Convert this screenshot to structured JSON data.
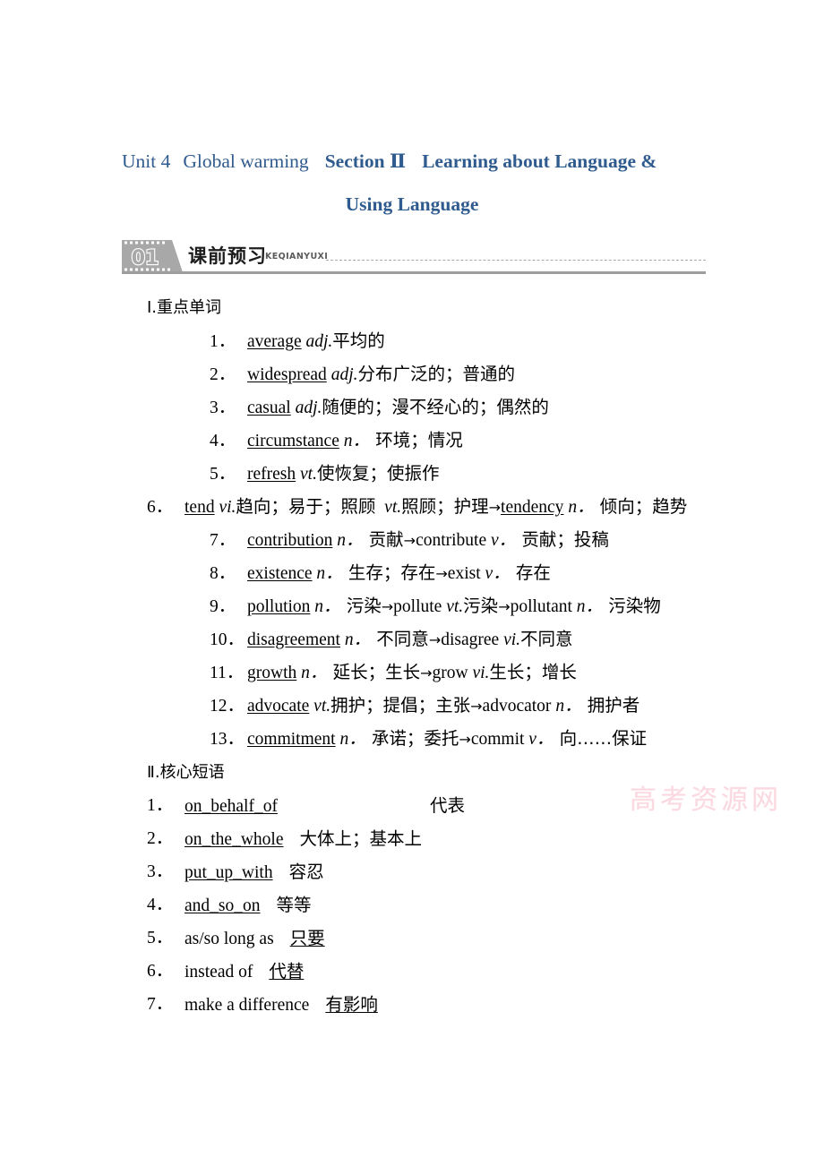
{
  "title": {
    "unit": "Unit 4",
    "topic": "Global warming",
    "section": "Section Ⅱ",
    "lesson_line1": "Learning about Language &",
    "lesson_line2": "Using Language"
  },
  "banner": {
    "number": "01",
    "cn": "课前预习",
    "pinyin": "KEQIANYUXI"
  },
  "watermark": "高考资源网",
  "colors": {
    "title_blue": "#2f5b8e",
    "rule_gray": "#9e9e9e",
    "watermark_pink": "#f9b9c8"
  },
  "section1": {
    "heading": "Ⅰ.重点单词",
    "items": [
      {
        "n": "1．",
        "word": "average",
        "pos": "adj.",
        "def": "平均的",
        "extra": ""
      },
      {
        "n": "2．",
        "word": "widespread",
        "pos": "adj.",
        "def": "分布广泛的；普通的",
        "extra": ""
      },
      {
        "n": "3．",
        "word": "casual",
        "pos": "adj.",
        "def": "随便的；漫不经心的；偶然的",
        "extra": ""
      },
      {
        "n": "4．",
        "word": "circumstance",
        "pos": "n．",
        "def": " 环境；情况",
        "extra": ""
      },
      {
        "n": "5．",
        "word": "refresh",
        "pos": "vt.",
        "def": "使恢复；使振作",
        "extra": ""
      },
      {
        "n": "6．",
        "word": "tend",
        "pos": "vi.",
        "def": "趋向；易于；照顾",
        "pos2": "vt.",
        "def2": "照顾；护理",
        "deriv": "tendency",
        "deriv_pos": "n．",
        "deriv_def": " 倾向；趋势"
      },
      {
        "n": "7．",
        "word": "contribution",
        "pos": "n．",
        "def": " 贡献",
        "deriv": "contribute",
        "deriv_pos": "v．",
        "deriv_def": " 贡献；投稿"
      },
      {
        "n": "8．",
        "word": "existence",
        "pos": "n．",
        "def": " 生存；存在",
        "deriv": "exist",
        "deriv_pos": "v．",
        "deriv_def": " 存在"
      },
      {
        "n": "9．",
        "word": "pollution",
        "pos": "n．",
        "def": " 污染",
        "deriv": "pollute",
        "deriv_pos": "vt.",
        "deriv_def": "污染",
        "deriv2": "pollutant",
        "deriv2_pos": "n．",
        "deriv2_def": " 污染物"
      },
      {
        "n": "10．",
        "word": "disagreement",
        "pos": "n．",
        "def": " 不同意",
        "deriv": "disagree",
        "deriv_pos": "vi.",
        "deriv_def": "不同意"
      },
      {
        "n": "11．",
        "word": "growth",
        "pos": "n．",
        "def": " 延长；生长",
        "deriv": "grow",
        "deriv_pos": "vi.",
        "deriv_def": "生长；增长"
      },
      {
        "n": "12．",
        "word": "advocate",
        "pos": "vt.",
        "def": "拥护；提倡；主张",
        "deriv": "advocator",
        "deriv_pos": "n．",
        "deriv_def": " 拥护者"
      },
      {
        "n": "13．",
        "word": "commitment",
        "pos": "n．",
        "def": " 承诺；委托",
        "deriv": "commit",
        "deriv_pos": "v．",
        "deriv_def": " 向……保证"
      }
    ],
    "item6_wrap": "趋势",
    "arrow": "→"
  },
  "section2": {
    "heading": "Ⅱ.核心短语",
    "items": [
      {
        "n": "1．",
        "en": "on_behalf_of",
        "en_underline": true,
        "cn": "代表",
        "cn_underline": false,
        "gap": "wide"
      },
      {
        "n": "2．",
        "en": "on_the_whole",
        "en_underline": true,
        "cn": "大体上；基本上",
        "cn_underline": false,
        "gap": "med"
      },
      {
        "n": "3．",
        "en": "put_up_with",
        "en_underline": true,
        "cn": "容忍",
        "cn_underline": false,
        "gap": "med"
      },
      {
        "n": "4．",
        "en": "and_so_on",
        "en_underline": true,
        "cn": "等等",
        "cn_underline": false,
        "gap": "med"
      },
      {
        "n": "5．",
        "en": "as/so long as",
        "en_underline": false,
        "cn": "只要",
        "cn_underline": true,
        "gap": "med"
      },
      {
        "n": "6．",
        "en": "instead of",
        "en_underline": false,
        "cn": "代替",
        "cn_underline": true,
        "gap": "med"
      },
      {
        "n": "7．",
        "en": "make a difference",
        "en_underline": false,
        "cn": "有影响",
        "cn_underline": true,
        "gap": "med"
      }
    ]
  }
}
